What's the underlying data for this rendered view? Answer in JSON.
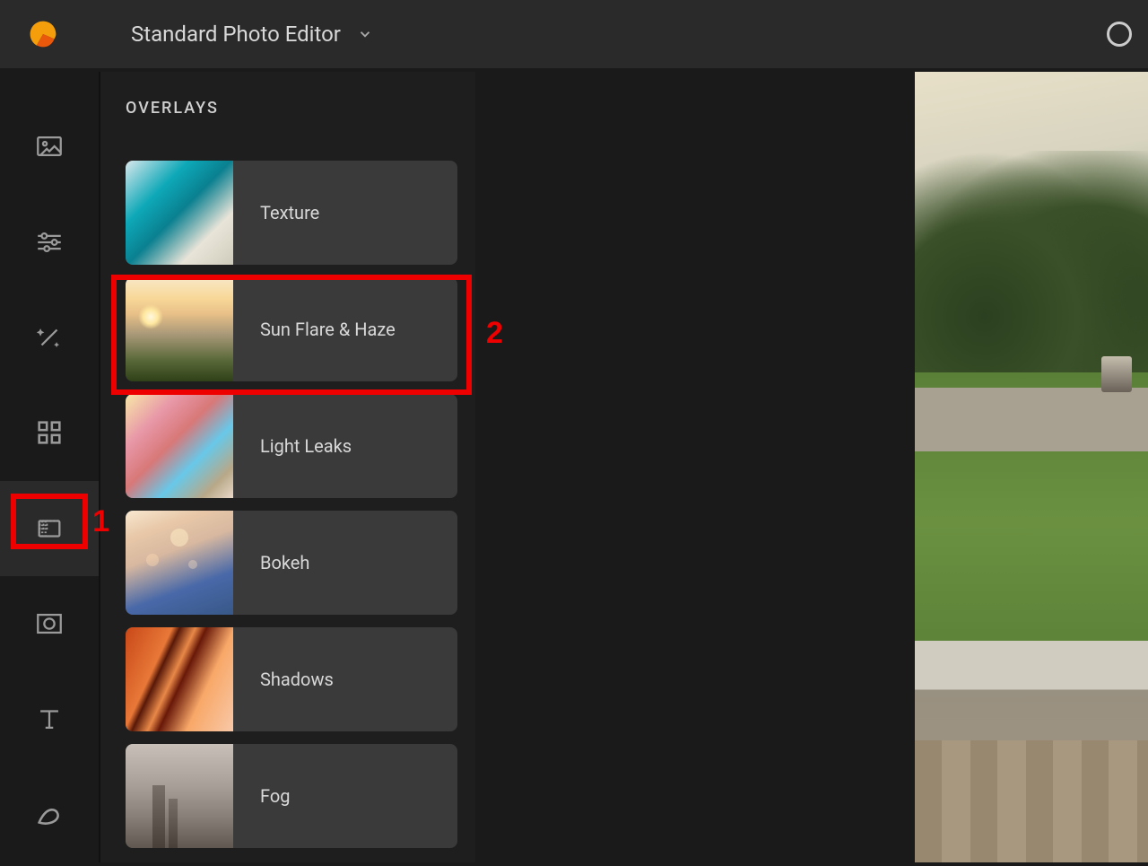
{
  "header": {
    "title": "Standard Photo Editor"
  },
  "panel": {
    "title": "OVERLAYS",
    "items": [
      {
        "label": "Texture"
      },
      {
        "label": "Sun Flare & Haze"
      },
      {
        "label": "Light Leaks"
      },
      {
        "label": "Bokeh"
      },
      {
        "label": "Shadows"
      },
      {
        "label": "Fog"
      }
    ]
  },
  "toolbar": {
    "icons": [
      "image",
      "sliders",
      "wand",
      "grid",
      "overlays",
      "frame",
      "text",
      "erase"
    ]
  },
  "annotations": {
    "a1": "1",
    "a2": "2"
  }
}
